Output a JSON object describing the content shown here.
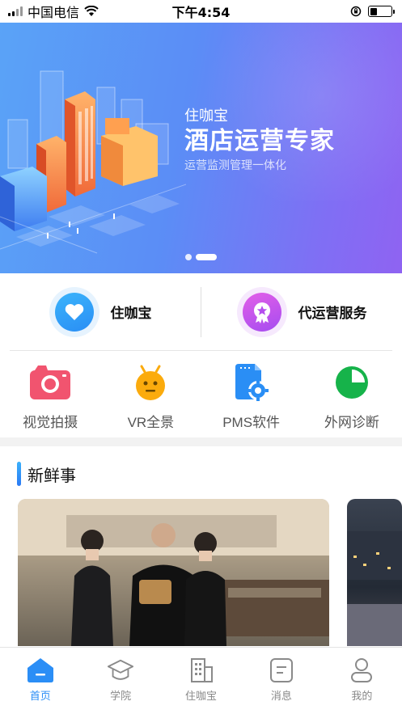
{
  "status_bar": {
    "carrier": "中国电信",
    "time": "下午4:54",
    "battery_level": 0.35
  },
  "banner": {
    "brand": "住咖宝",
    "title": "酒店运营专家",
    "subtitle": "运营监测管理一体化",
    "slide_count": 2,
    "active_slide": 2
  },
  "features": [
    {
      "label": "住咖宝",
      "icon": "heart-icon"
    },
    {
      "label": "代运营服务",
      "icon": "star-badge-icon"
    }
  ],
  "tools": [
    {
      "label": "视觉拍摄",
      "icon": "camera-icon",
      "color": "#f1546f"
    },
    {
      "label": "VR全景",
      "icon": "android-robot-icon",
      "color": "#fbab0d"
    },
    {
      "label": "PMS软件",
      "icon": "document-gear-icon",
      "color": "#2a8ef5"
    },
    {
      "label": "外网诊断",
      "icon": "pie-chart-icon",
      "color": "#16b34a"
    }
  ],
  "news": {
    "title": "新鲜事"
  },
  "tabbar": {
    "items": [
      {
        "label": "首页",
        "icon": "home-icon",
        "active": true
      },
      {
        "label": "学院",
        "icon": "graduation-cap-icon",
        "active": false
      },
      {
        "label": "住咖宝",
        "icon": "building-icon",
        "active": false
      },
      {
        "label": "消息",
        "icon": "message-icon",
        "active": false
      },
      {
        "label": "我的",
        "icon": "user-icon",
        "active": false
      }
    ]
  },
  "colors": {
    "accent": "#2b8ef6",
    "banner_start": "#5aa3f7",
    "banner_end": "#8f63f2"
  }
}
